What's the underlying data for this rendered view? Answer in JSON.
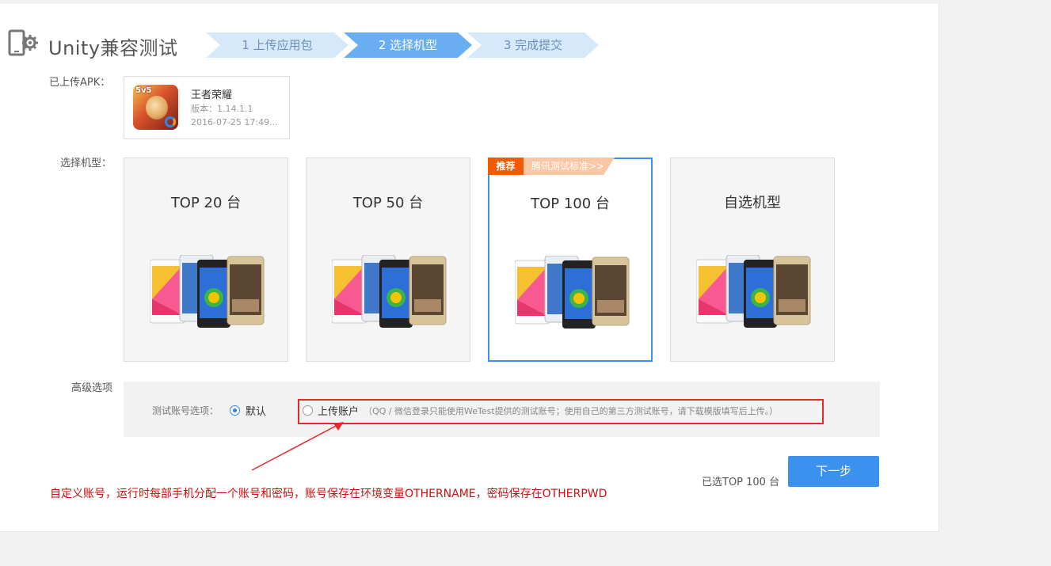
{
  "header": {
    "title": "Unity兼容测试",
    "steps": [
      "1 上传应用包",
      "2 选择机型",
      "3 完成提交"
    ]
  },
  "apk": {
    "label": "已上传APK：",
    "name": "王者荣耀",
    "version": "版本：1.14.1.1",
    "date": "2016-07-25 17:49...",
    "icon": "game-app-icon",
    "icon_badge": "5v5"
  },
  "models": {
    "label": "选择机型：",
    "options": [
      {
        "title": "TOP 20 台",
        "selected": false
      },
      {
        "title": "TOP 50 台",
        "selected": false
      },
      {
        "title": "TOP 100 台",
        "selected": true
      },
      {
        "title": "自选机型",
        "selected": false
      }
    ],
    "recommend_tag": "推荐",
    "recommend_link": "腾讯测试标准>>"
  },
  "advanced": {
    "label": "高级选项",
    "account_label": "测试账号选项：",
    "default_option": "默认",
    "upload_option": "上传账户",
    "upload_note": "（QQ / 微信登录只能使用WeTest提供的测试账号；使用自己的第三方测试账号，请下载模版填写后上传。）",
    "selected_option": "默认"
  },
  "footer": {
    "selected_text": "已选TOP 100 台",
    "next_button": "下一步"
  },
  "annotation": "自定义账号，运行时每部手机分配一个账号和密码，账号保存在环境变量OTHERNAME，密码保存在OTHERPWD",
  "colors": {
    "accent": "#3a92ee",
    "step_active": "#6aaef2",
    "step_inactive": "#d6e9fb",
    "recommend": "#f05a00",
    "annotation": "#cc1010"
  }
}
